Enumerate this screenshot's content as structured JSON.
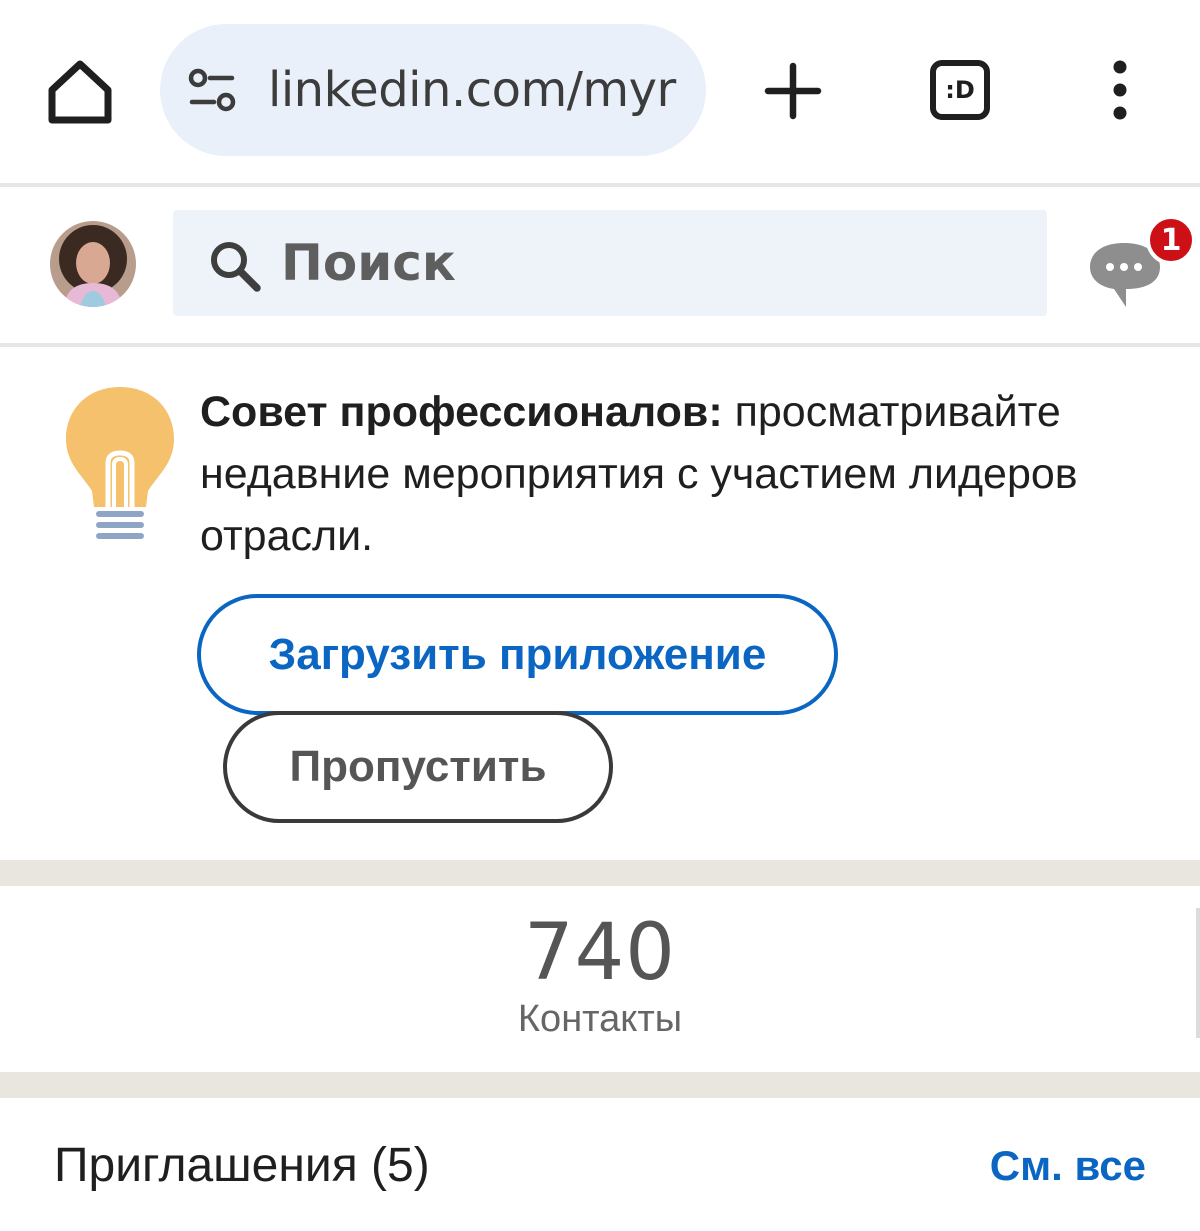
{
  "browser": {
    "url": "linkedin.com/myr",
    "tab_count_label": ":D",
    "icons": [
      "home-icon",
      "site-settings-icon",
      "new-tab-icon",
      "tab-switcher-icon",
      "more-menu-icon"
    ]
  },
  "header": {
    "search_placeholder": "Поиск",
    "message_badge": "1",
    "icons": [
      "avatar",
      "search-icon",
      "messaging-icon"
    ]
  },
  "tip": {
    "bold_prefix": "Совет профессионалов:",
    "text": " просматривайте недавние мероприятия с участием лидеров отрасли.",
    "download_button": "Загрузить приложение",
    "skip_button": "Пропустить",
    "icon": "lightbulb-icon"
  },
  "connections": {
    "count": "740",
    "label": "Контакты"
  },
  "invitations": {
    "title": "Приглашения (5)",
    "see_all": "См. все"
  },
  "colors": {
    "accent": "#0a66c2",
    "badge": "#cc1016",
    "bulb": "#f5c16c",
    "bulb_base": "#8ea5c6",
    "band": "#e9e5df"
  }
}
